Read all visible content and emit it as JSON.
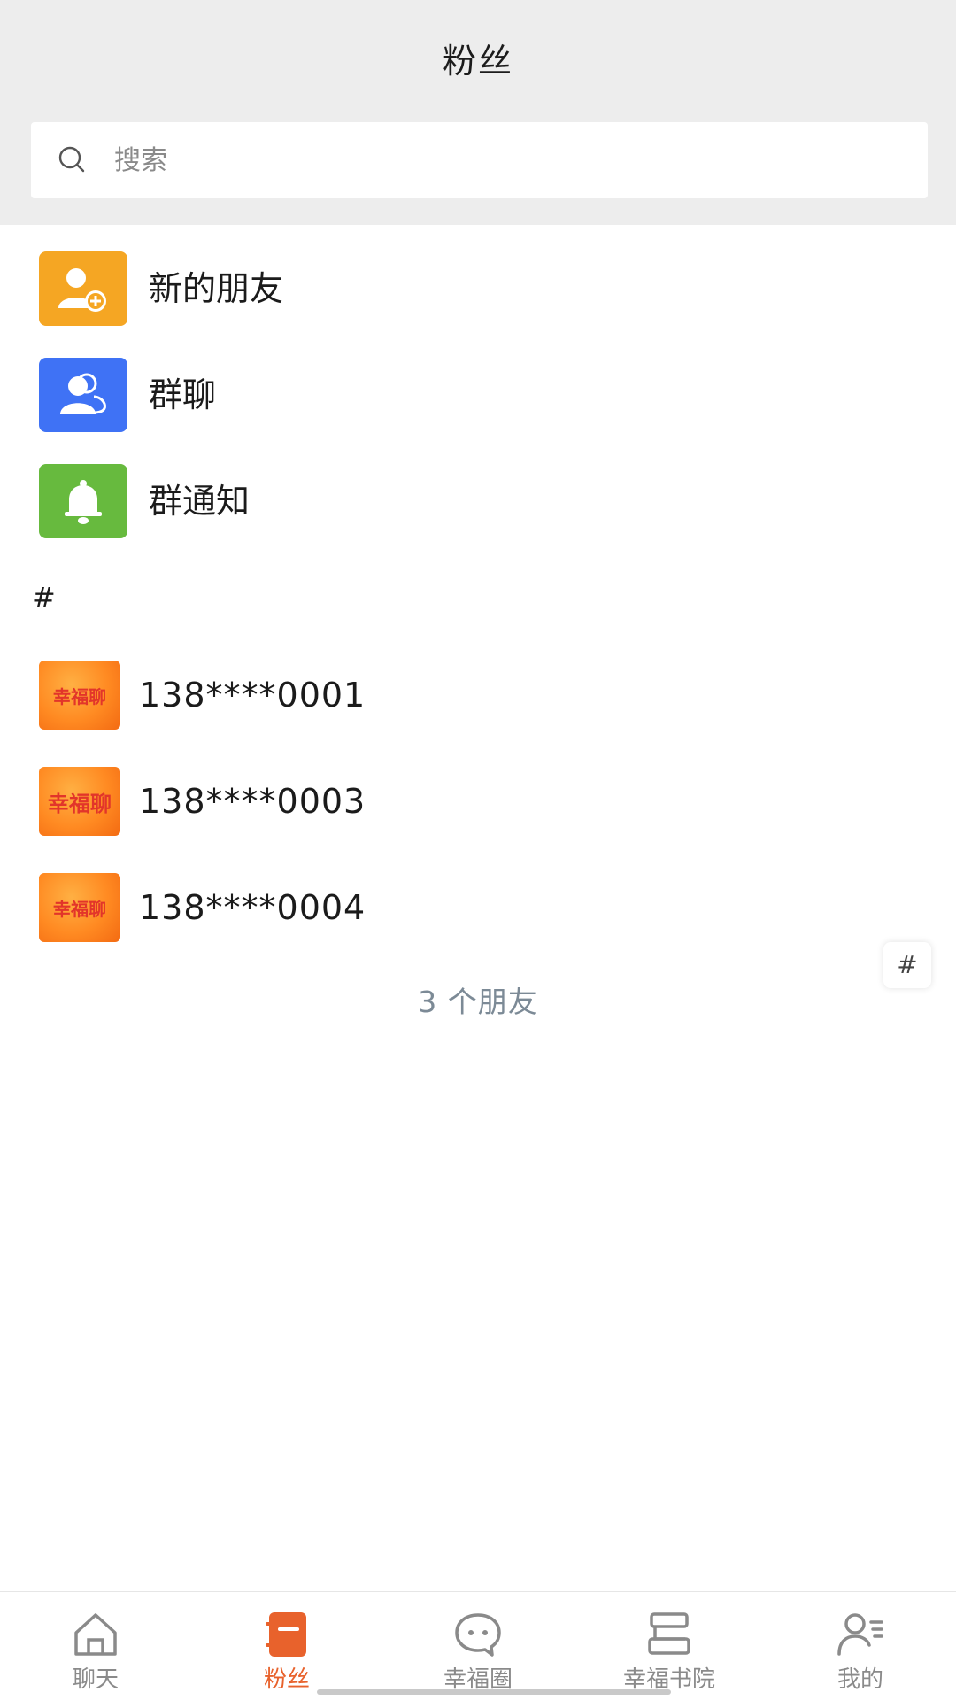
{
  "header": {
    "title": "粉丝"
  },
  "search": {
    "placeholder": "搜索"
  },
  "menu": [
    {
      "label": "新的朋友",
      "icon": "add-friend-icon",
      "color": "#f5a623"
    },
    {
      "label": "群聊",
      "icon": "group-icon",
      "color": "#3f72f5"
    },
    {
      "label": "群通知",
      "icon": "bell-icon",
      "color": "#67ba3e"
    }
  ],
  "section": {
    "letter": "#"
  },
  "contacts": [
    {
      "name": "138****0001",
      "avatar_text": "幸福聊"
    },
    {
      "name": "138****0003",
      "avatar_text": "幸福聊"
    },
    {
      "name": "138****0004",
      "avatar_text": "幸福聊"
    }
  ],
  "footer": {
    "count_text": "3 个朋友"
  },
  "index_bar": {
    "letter": "#"
  },
  "tabbar": {
    "active_color": "#e8622c",
    "items": [
      {
        "label": "聊天",
        "icon": "home-icon"
      },
      {
        "label": "粉丝",
        "icon": "contacts-book-icon",
        "active": true
      },
      {
        "label": "幸福圈",
        "icon": "chat-bubble-icon"
      },
      {
        "label": "幸福书院",
        "icon": "books-icon"
      },
      {
        "label": "我的",
        "icon": "profile-icon"
      }
    ]
  }
}
